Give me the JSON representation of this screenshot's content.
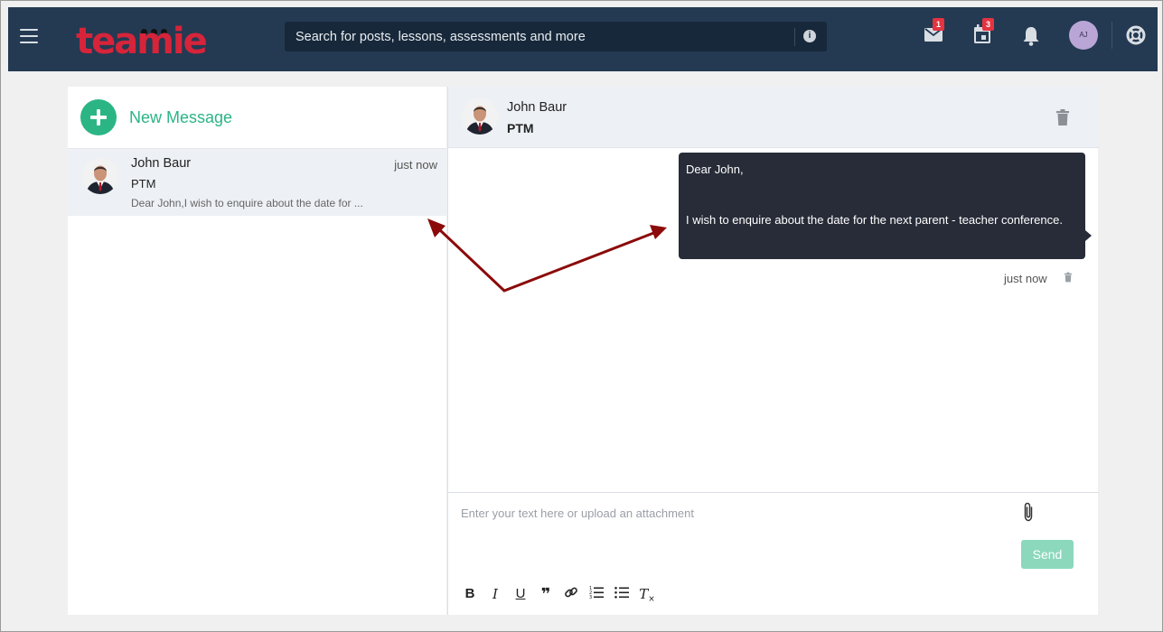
{
  "header": {
    "logo_text": "teamie",
    "search_placeholder": "Search for posts, lessons, assessments and more",
    "mail_badge": "1",
    "calendar_badge": "3",
    "user_initials": "AJ",
    "icons": [
      "menu-icon",
      "info-icon",
      "mail-icon",
      "calendar-icon",
      "bell-icon",
      "help-lifebuoy-icon"
    ]
  },
  "sidebar": {
    "new_message_label": "New Message",
    "conversations": [
      {
        "name": "John Baur",
        "time": "just now",
        "subject": "PTM",
        "preview": "Dear John,I wish to enquire about the date for ..."
      }
    ]
  },
  "thread": {
    "name": "John Baur",
    "subject": "PTM",
    "message": {
      "line1": "Dear John,",
      "line2": "I wish to enquire about the date for the next parent - teacher conference.",
      "time": "just now"
    },
    "composer_placeholder": "Enter your text here or upload an attachment",
    "send_label": "Send",
    "toolbar": {
      "bold": "B",
      "italic": "I",
      "underline": "U",
      "quote": "❞",
      "clear": "T"
    }
  },
  "colors": {
    "header_bg": "#243a52",
    "brand_red": "#d6243a",
    "accent_green": "#2bb585",
    "bubble_bg": "#272c38",
    "annotation_arrow": "#8b0a0a"
  }
}
